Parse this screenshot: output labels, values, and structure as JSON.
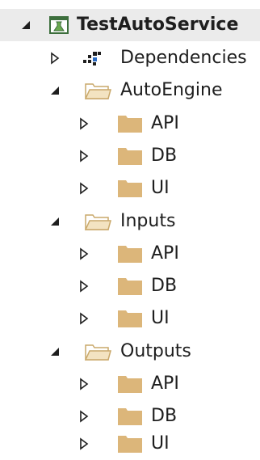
{
  "tree": {
    "root": {
      "label": "TestAutoService",
      "expanded": true,
      "icon": "test-project-icon"
    },
    "dependencies": {
      "label": "Dependencies",
      "expanded": false,
      "icon": "dependencies-icon"
    },
    "folders": [
      {
        "label": "AutoEngine",
        "expanded": true,
        "children": [
          {
            "label": "API",
            "expanded": false
          },
          {
            "label": "DB",
            "expanded": false
          },
          {
            "label": "UI",
            "expanded": false
          }
        ]
      },
      {
        "label": "Inputs",
        "expanded": true,
        "children": [
          {
            "label": "API",
            "expanded": false
          },
          {
            "label": "DB",
            "expanded": false
          },
          {
            "label": "UI",
            "expanded": false
          }
        ]
      },
      {
        "label": "Outputs",
        "expanded": true,
        "children": [
          {
            "label": "API",
            "expanded": false
          },
          {
            "label": "DB",
            "expanded": false
          },
          {
            "label": "UI",
            "expanded": false
          }
        ]
      }
    ]
  },
  "colors": {
    "root_row_background": "#ebebeb",
    "folder_fill": "#dcb67a",
    "folder_open_outline": "#c9a86a",
    "text": "#1e1e1e",
    "arrow": "#1e1e1e"
  }
}
